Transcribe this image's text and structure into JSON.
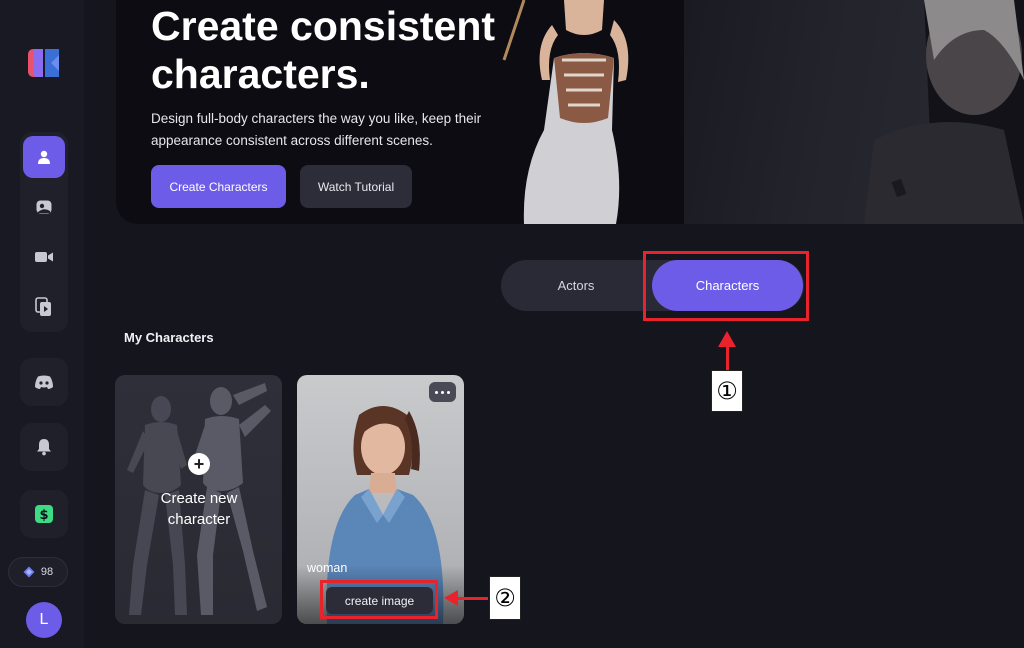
{
  "hero": {
    "title": "Create consistent characters.",
    "description": "Design full-body characters the way you like, keep their appearance consistent across different scenes.",
    "create_button": "Create Characters",
    "tutorial_button": "Watch Tutorial"
  },
  "sidebar": {
    "nav_items": [
      {
        "icon": "user-icon",
        "active": true
      },
      {
        "icon": "image-icon",
        "active": false
      },
      {
        "icon": "video-icon",
        "active": false
      },
      {
        "icon": "video-library-icon",
        "active": false
      }
    ],
    "discord_icon": "discord-icon",
    "bell_icon": "bell-icon",
    "money_icon": "money-icon",
    "credits": "98",
    "avatar_initial": "L"
  },
  "toggle": {
    "actors_label": "Actors",
    "characters_label": "Characters",
    "selected": "Characters"
  },
  "section": {
    "title": "My Characters"
  },
  "cards": {
    "new_character_label": "Create new character",
    "new_plus": "+",
    "woman_name": "woman",
    "create_image_button": "create image"
  },
  "annotations": {
    "marker_1": "①",
    "marker_2": "②"
  },
  "colors": {
    "accent": "#6c5ce7",
    "highlight": "#e8232c",
    "background": "#15151e",
    "sidebar": "#191923"
  }
}
